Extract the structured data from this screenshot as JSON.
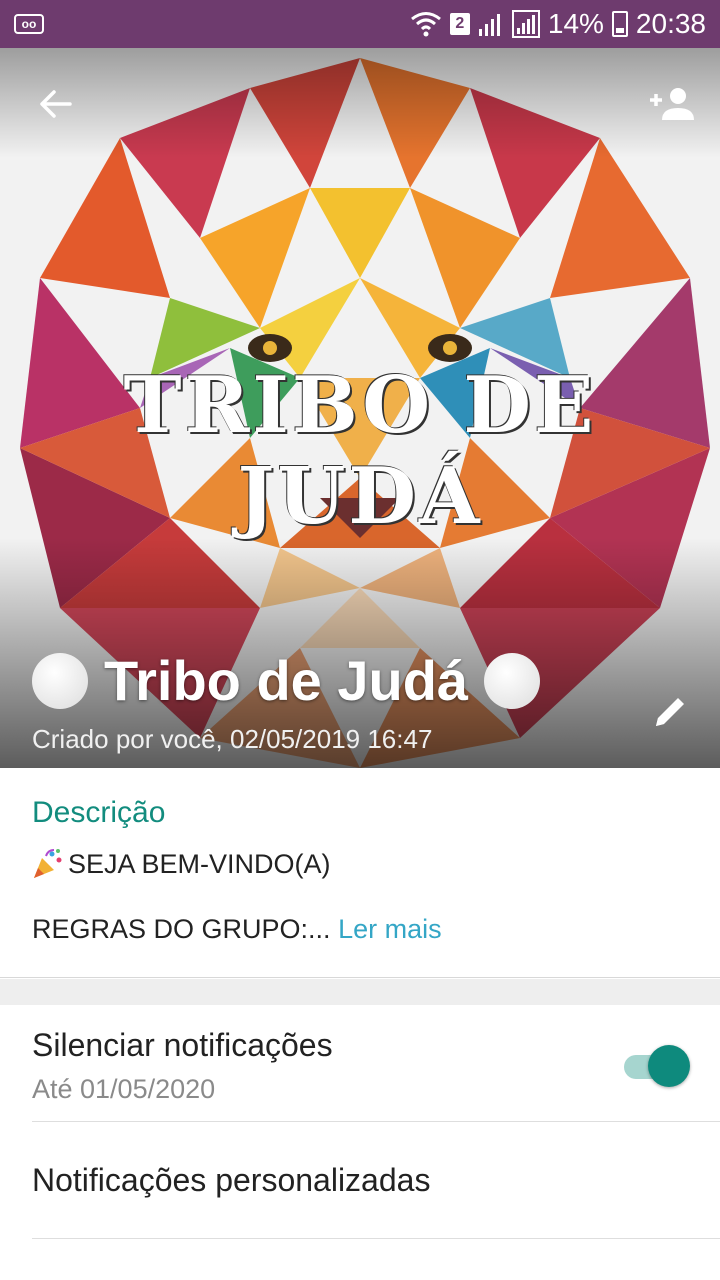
{
  "status_bar": {
    "sim_slot": "2",
    "battery": "14%",
    "time": "20:38"
  },
  "group": {
    "name": "Tribo de Judá",
    "created": "Criado por você, 02/05/2019 16:47",
    "image_text": "TRIBO DE JUDÁ"
  },
  "description": {
    "title": "Descrição",
    "line1": "SEJA BEM-VINDO(A)",
    "rules": "REGRAS DO GRUPO:...",
    "read_more": "Ler mais"
  },
  "settings": {
    "mute_label": "Silenciar notificações",
    "mute_until": "Até 01/05/2020",
    "mute_on": true,
    "custom_label": "Notificações personalizadas"
  },
  "colors": {
    "status_bar": "#6e3b6e",
    "accent": "#128c7e",
    "link": "#34a6c6"
  },
  "icons": [
    "voicemail-icon",
    "wifi-icon",
    "signal-icon",
    "battery-icon",
    "back-arrow-icon",
    "add-participant-icon",
    "edit-pencil-icon",
    "party-popper-icon"
  ]
}
